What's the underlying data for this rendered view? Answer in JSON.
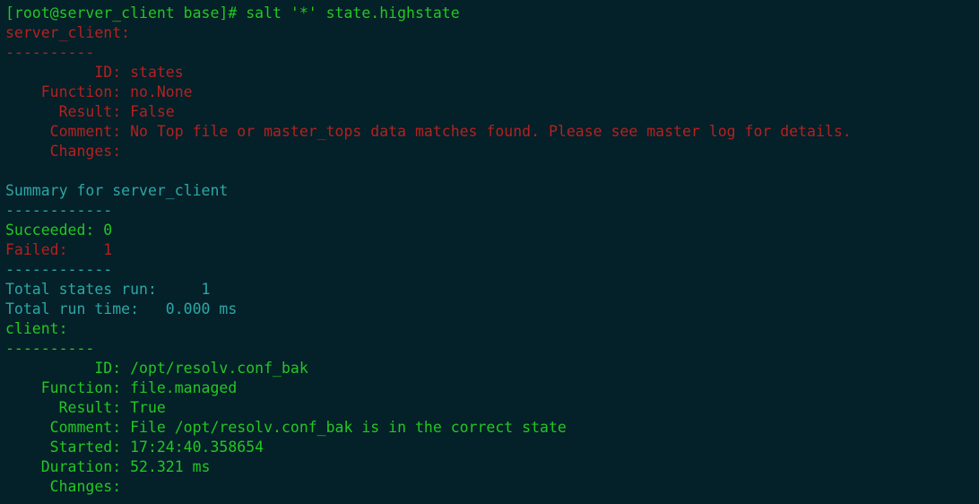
{
  "terminal": {
    "background_color": "#042028",
    "colors": {
      "green": "#23c723",
      "red": "#b42121",
      "cyan": "#2ba7a7"
    },
    "prompt": {
      "text": "[root@server_client base]# ",
      "command": "salt '*' state.highstate"
    },
    "lines": [
      {
        "id": "prompt-line",
        "segments": [
          {
            "text": "[root@server_client base]# ",
            "color": "green"
          },
          {
            "text": "salt '*' state.highstate",
            "color": "green"
          }
        ]
      },
      {
        "id": "minion-server-client-header",
        "segments": [
          {
            "text": "server_client:",
            "color": "red"
          }
        ]
      },
      {
        "id": "minion-server-client-rule",
        "segments": [
          {
            "text": "----------",
            "color": "red"
          }
        ]
      },
      {
        "id": "server-client-state-id",
        "segments": [
          {
            "text": "          ID: states",
            "color": "red"
          }
        ]
      },
      {
        "id": "server-client-state-function",
        "segments": [
          {
            "text": "    Function: no.None",
            "color": "red"
          }
        ]
      },
      {
        "id": "server-client-state-result",
        "segments": [
          {
            "text": "      Result: False",
            "color": "red"
          }
        ]
      },
      {
        "id": "server-client-state-comment",
        "segments": [
          {
            "text": "     Comment: No Top file or master_tops data matches found. Please see master log for details.",
            "color": "red"
          }
        ]
      },
      {
        "id": "server-client-state-changes",
        "segments": [
          {
            "text": "     Changes:",
            "color": "red"
          }
        ]
      },
      {
        "id": "blank-1",
        "segments": [
          {
            "text": " ",
            "color": "green"
          }
        ]
      },
      {
        "id": "summary-header",
        "segments": [
          {
            "text": "Summary for server_client",
            "color": "cyan"
          }
        ]
      },
      {
        "id": "summary-rule-top",
        "segments": [
          {
            "text": "------------",
            "color": "cyan"
          }
        ]
      },
      {
        "id": "summary-succeeded",
        "segments": [
          {
            "text": "Succeeded: 0",
            "color": "green"
          }
        ]
      },
      {
        "id": "summary-failed",
        "segments": [
          {
            "text": "Failed:    1",
            "color": "red"
          }
        ]
      },
      {
        "id": "summary-rule-bottom",
        "segments": [
          {
            "text": "------------",
            "color": "cyan"
          }
        ]
      },
      {
        "id": "total-states-run",
        "segments": [
          {
            "text": "Total states run:     1",
            "color": "cyan"
          }
        ]
      },
      {
        "id": "total-run-time",
        "segments": [
          {
            "text": "Total run time:   0.000 ms",
            "color": "cyan"
          }
        ]
      },
      {
        "id": "minion-client-header",
        "segments": [
          {
            "text": "client:",
            "color": "green"
          }
        ]
      },
      {
        "id": "minion-client-rule",
        "segments": [
          {
            "text": "----------",
            "color": "green"
          }
        ]
      },
      {
        "id": "client-state-id",
        "segments": [
          {
            "text": "          ID: /opt/resolv.conf_bak",
            "color": "green"
          }
        ]
      },
      {
        "id": "client-state-function",
        "segments": [
          {
            "text": "    Function: file.managed",
            "color": "green"
          }
        ]
      },
      {
        "id": "client-state-result",
        "segments": [
          {
            "text": "      Result: True",
            "color": "green"
          }
        ]
      },
      {
        "id": "client-state-comment",
        "segments": [
          {
            "text": "     Comment: File /opt/resolv.conf_bak is in the correct state",
            "color": "green"
          }
        ]
      },
      {
        "id": "client-state-started",
        "segments": [
          {
            "text": "     Started: 17:24:40.358654",
            "color": "green"
          }
        ]
      },
      {
        "id": "client-state-duration",
        "segments": [
          {
            "text": "    Duration: 52.321 ms",
            "color": "green"
          }
        ]
      },
      {
        "id": "client-state-changes",
        "segments": [
          {
            "text": "     Changes:",
            "color": "green"
          }
        ]
      }
    ]
  }
}
